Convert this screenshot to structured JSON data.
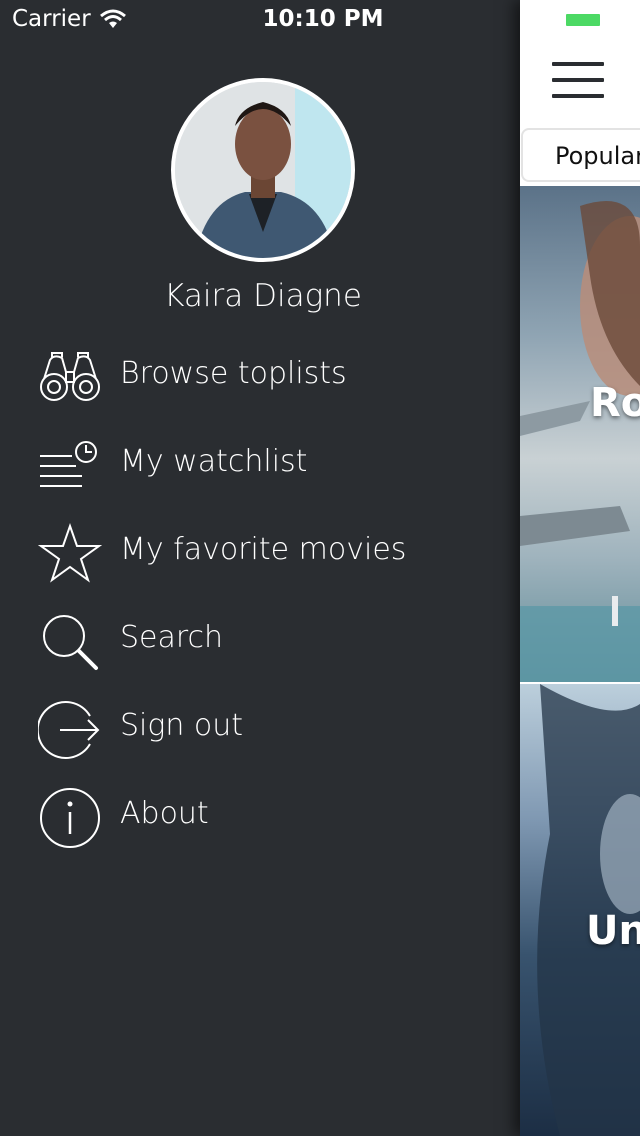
{
  "status_bar": {
    "carrier": "Carrier",
    "time": "10:10 PM",
    "battery_color": "#4cd964"
  },
  "drawer": {
    "user_name": "Kaira Diagne",
    "menu": [
      {
        "label": "Browse toplists",
        "icon": "binoculars-icon"
      },
      {
        "label": "My watchlist",
        "icon": "watchlist-clock-icon"
      },
      {
        "label": "My favorite movies",
        "icon": "star-icon"
      },
      {
        "label": "Search",
        "icon": "search-icon"
      },
      {
        "label": "Sign out",
        "icon": "sign-out-icon"
      },
      {
        "label": "About",
        "icon": "info-icon"
      }
    ]
  },
  "main": {
    "segment_label": "Popular",
    "posters": [
      {
        "title_fragment": "Ro"
      },
      {
        "title_fragment": "Un"
      }
    ]
  },
  "colors": {
    "drawer_background": "#2a2d31",
    "text": "#ffffff"
  }
}
